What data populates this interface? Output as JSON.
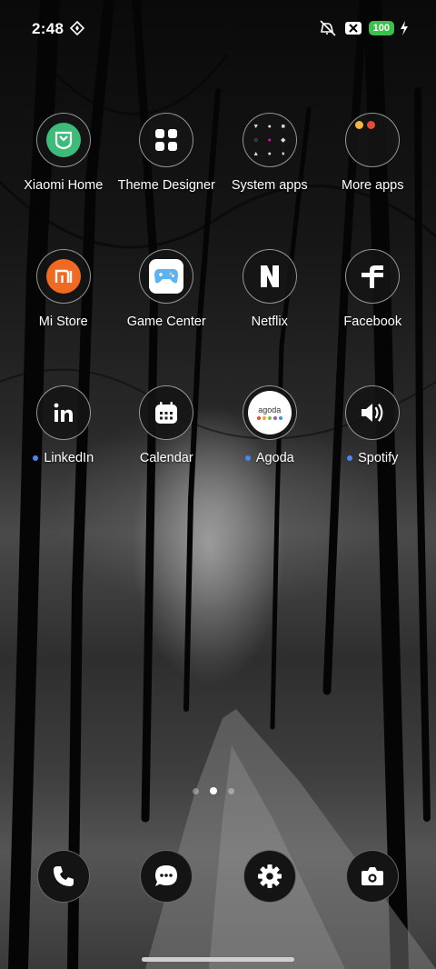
{
  "status_bar": {
    "time": "2:48",
    "battery": "100",
    "icons": [
      "location-icon",
      "mute-icon",
      "sim-off-icon",
      "charging-icon"
    ]
  },
  "apps": [
    {
      "label": "Xiaomi Home",
      "icon": "mi-home-icon",
      "badge": false
    },
    {
      "label": "Theme Designer",
      "icon": "theme-grid-icon",
      "badge": false
    },
    {
      "label": "System apps",
      "icon": "folder-icon",
      "badge": false
    },
    {
      "label": "More apps",
      "icon": "folder-icon",
      "badge": false
    },
    {
      "label": "Mi Store",
      "icon": "mi-store-icon",
      "badge": false
    },
    {
      "label": "Game Center",
      "icon": "gamepad-icon",
      "badge": false
    },
    {
      "label": "Netflix",
      "icon": "netflix-icon",
      "badge": false
    },
    {
      "label": "Facebook",
      "icon": "facebook-icon",
      "badge": false
    },
    {
      "label": "LinkedIn",
      "icon": "linkedin-icon",
      "badge": true
    },
    {
      "label": "Calendar",
      "icon": "calendar-icon",
      "badge": false
    },
    {
      "label": "Agoda",
      "icon": "agoda-icon",
      "badge": true
    },
    {
      "label": "Spotify",
      "icon": "speaker-icon",
      "badge": true
    }
  ],
  "agoda_logo_text": "agoda",
  "dock": [
    "phone-icon",
    "messages-icon",
    "settings-icon",
    "camera-icon"
  ],
  "colors": {
    "mi_home": "#3dbb78",
    "mi_store": "#f06a23",
    "game_center": "#5bb3f5",
    "battery": "#3bc14a",
    "badge_dot": "#4a86f7"
  },
  "pages": {
    "count": 3,
    "active": 2
  }
}
